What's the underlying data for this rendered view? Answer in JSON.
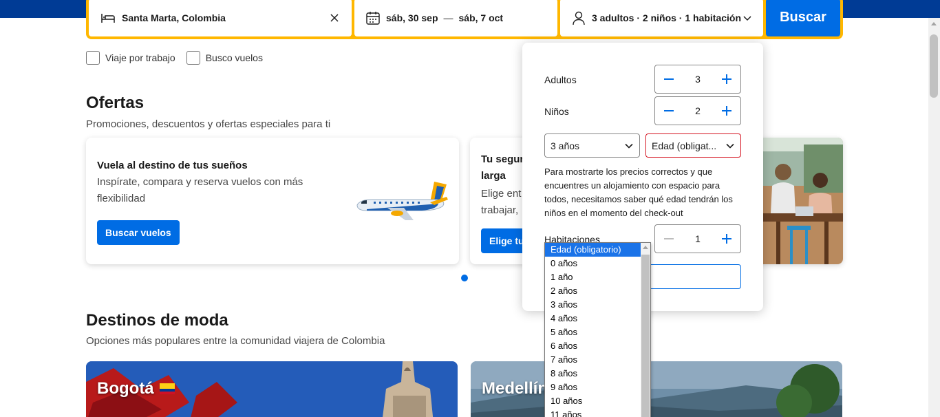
{
  "search": {
    "destination": "Santa Marta, Colombia",
    "date_start": "sáb, 30 sep",
    "date_separator": "—",
    "date_end": "sáb, 7 oct",
    "guests": "3 adultos · 2 niños · 1 habitación",
    "button_label": "Buscar"
  },
  "checkboxes": [
    {
      "label": "Viaje por trabajo",
      "checked": false
    },
    {
      "label": "Busco vuelos",
      "checked": false
    }
  ],
  "offers": {
    "title": "Ofertas",
    "subtitle": "Promociones, descuentos y ofertas especiales para ti",
    "card1": {
      "title": "Vuela al destino de tus sueños",
      "body": "Inspírate, compara y reserva vuelos con más flexibilidad",
      "button": "Buscar vuelos"
    },
    "card2": {
      "title": "Tu segur larga",
      "body": "Elige ent trabajar,",
      "button": "Elige tu"
    }
  },
  "trending": {
    "title": "Destinos de moda",
    "subtitle": "Opciones más populares entre la comunidad viajera de Colombia",
    "items": [
      {
        "label": "Bogotá"
      },
      {
        "label": "Medellín"
      }
    ]
  },
  "guest_popover": {
    "adults_label": "Adultos",
    "adults_value": "3",
    "children_label": "Niños",
    "children_value": "2",
    "child_age_1": "3 años",
    "child_age_2": "Edad (obligat...",
    "note": "Para mostrarte los precios correctos y que encuentres un alojamiento con espacio para todos, necesitamos saber qué edad tendrán los niños en el momento del check-out",
    "rooms_label": "Habitaciones",
    "rooms_value": "1"
  },
  "age_options": [
    "Edad (obligatorio)",
    "0 años",
    "1 año",
    "2 años",
    "3 años",
    "4 años",
    "5 años",
    "6 años",
    "7 años",
    "8 años",
    "9 años",
    "10 años",
    "11 años"
  ],
  "colors": {
    "brand_blue": "#003b95",
    "action_blue": "#006ce4",
    "search_yellow": "#ffb700",
    "error_red": "#d4111e"
  }
}
